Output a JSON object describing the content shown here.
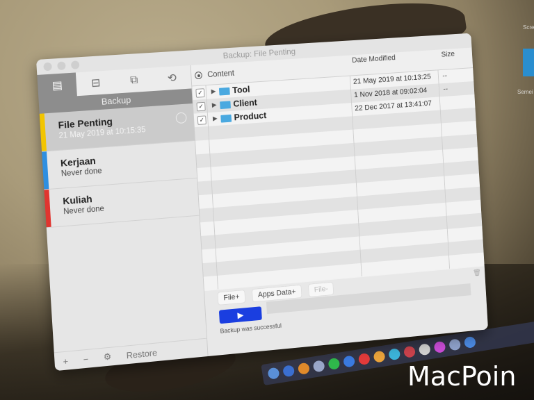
{
  "window": {
    "title": "Backup: File Penting"
  },
  "sidebar": {
    "tabs": [
      {
        "icon": "drawer-icon",
        "glyph": "▤",
        "active": true
      },
      {
        "icon": "archive-box-icon",
        "glyph": "⊟",
        "active": false
      },
      {
        "icon": "duplicate-icon",
        "glyph": "⧉",
        "active": false
      },
      {
        "icon": "sync-icon",
        "glyph": "⟲",
        "active": false
      }
    ],
    "section_label": "Backup",
    "items": [
      {
        "name": "File Penting",
        "sub": "21 May 2019 at 10:15:35",
        "color": "#f2c500",
        "selected": true
      },
      {
        "name": "Kerjaan",
        "sub": "Never done",
        "color": "#2f8fe0",
        "selected": false
      },
      {
        "name": "Kuliah",
        "sub": "Never done",
        "color": "#e0352f",
        "selected": false
      }
    ],
    "footer": {
      "add": "+",
      "remove": "−",
      "settings": "⚙",
      "restore": "Restore"
    }
  },
  "table": {
    "headers": {
      "content": "Content",
      "date": "Date Modified",
      "size": "Size"
    },
    "rows": [
      {
        "checked": true,
        "name": "Tool",
        "date": "21 May 2019 at 10:13:25",
        "size": "--"
      },
      {
        "checked": true,
        "name": "Client",
        "date": "1 Nov 2018 at 09:02:04",
        "size": "--"
      },
      {
        "checked": true,
        "name": "Product",
        "date": "22 Dec 2017 at 13:41:07",
        "size": "--"
      }
    ]
  },
  "actions": {
    "file_add": "File+",
    "apps_data_add": "Apps Data+",
    "file_remove": "File-",
    "run": "▶",
    "status": "Backup was successful"
  },
  "desktop": {
    "labels": [
      "Scre",
      "Semei"
    ],
    "brand": "MacPoin"
  }
}
